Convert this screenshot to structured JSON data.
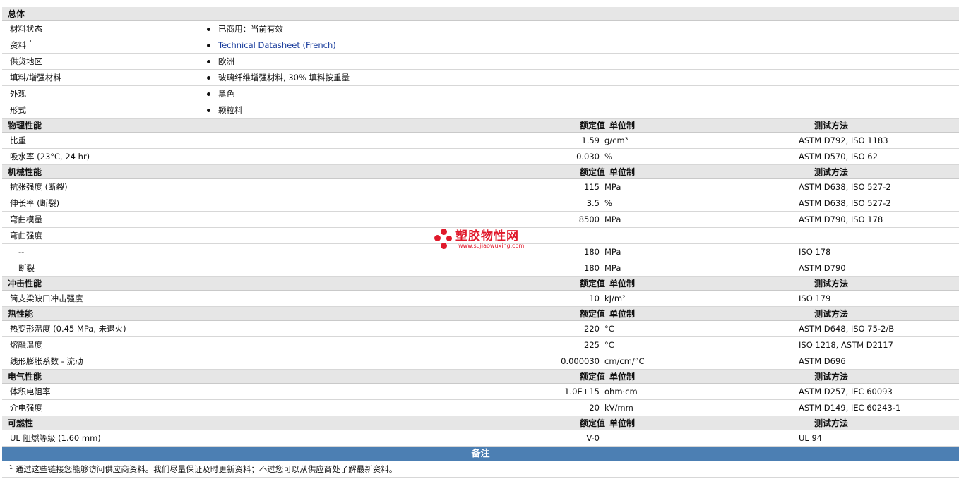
{
  "general": {
    "title": "总体",
    "rows": [
      {
        "label": "材料状态",
        "value": "已商用：当前有效"
      },
      {
        "label": "资料",
        "sup": "1",
        "value": "Technical Datasheet (French)",
        "link": true
      },
      {
        "label": "供货地区",
        "value": "欧洲"
      },
      {
        "label": "填料/增强材料",
        "value": "玻璃纤维增强材料, 30% 填料按重量"
      },
      {
        "label": "外观",
        "value": "黑色"
      },
      {
        "label": "形式",
        "value": "颗粒料"
      }
    ]
  },
  "columns": {
    "value": "额定值",
    "unit": "单位制",
    "test": "测试方法"
  },
  "sections": [
    {
      "title": "物理性能",
      "rows": [
        {
          "label": "比重",
          "value": "1.59",
          "unit": "g/cm³",
          "test": "ASTM D792, ISO 1183"
        },
        {
          "label": "吸水率 (23°C, 24 hr)",
          "value": "0.030",
          "unit": "%",
          "test": "ASTM D570, ISO 62"
        }
      ]
    },
    {
      "title": "机械性能",
      "rows": [
        {
          "label": "抗张强度 (断裂)",
          "value": "115",
          "unit": "MPa",
          "test": "ASTM D638, ISO 527-2"
        },
        {
          "label": "伸长率 (断裂)",
          "value": "3.5",
          "unit": "%",
          "test": "ASTM D638, ISO 527-2"
        },
        {
          "label": "弯曲模量",
          "value": "8500",
          "unit": "MPa",
          "test": "ASTM D790, ISO 178"
        },
        {
          "label": "弯曲强度",
          "value": "",
          "unit": "",
          "test": ""
        },
        {
          "label": "--",
          "sub": true,
          "value": "180",
          "unit": "MPa",
          "test": "ISO 178"
        },
        {
          "label": "断裂",
          "sub": true,
          "value": "180",
          "unit": "MPa",
          "test": "ASTM D790"
        }
      ]
    },
    {
      "title": "冲击性能",
      "rows": [
        {
          "label": "简支梁缺口冲击强度",
          "value": "10",
          "unit": "kJ/m²",
          "test": "ISO 179"
        }
      ]
    },
    {
      "title": "热性能",
      "rows": [
        {
          "label": "热变形温度 (0.45 MPa, 未退火)",
          "value": "220",
          "unit": "°C",
          "test": "ASTM D648, ISO 75-2/B"
        },
        {
          "label": "熔融温度",
          "value": "225",
          "unit": "°C",
          "test": "ISO 1218, ASTM D2117"
        },
        {
          "label": "线形膨胀系数 - 流动",
          "value": "0.000030",
          "unit": "cm/cm/°C",
          "test": "ASTM D696"
        }
      ]
    },
    {
      "title": "电气性能",
      "rows": [
        {
          "label": "体积电阻率",
          "value": "1.0E+15",
          "unit": "ohm·cm",
          "test": "ASTM D257, IEC 60093"
        },
        {
          "label": "介电强度",
          "value": "20",
          "unit": "kV/mm",
          "test": "ASTM D149, IEC 60243-1"
        }
      ]
    },
    {
      "title": "可燃性",
      "rows": [
        {
          "label": "UL 阻燃等级 (1.60 mm)",
          "value": "V-0",
          "unit": "",
          "test": "UL 94"
        }
      ]
    }
  ],
  "notes": {
    "title": "备注",
    "sup": "1",
    "text": "通过这些链接您能够访问供应商资料。我们尽量保证及时更新资料；不过您可以从供应商处了解最新资料。"
  },
  "watermark": {
    "brand": "塑胶物性网",
    "url": "www.sujiaowuxing.com",
    "color": "#e0192b"
  }
}
